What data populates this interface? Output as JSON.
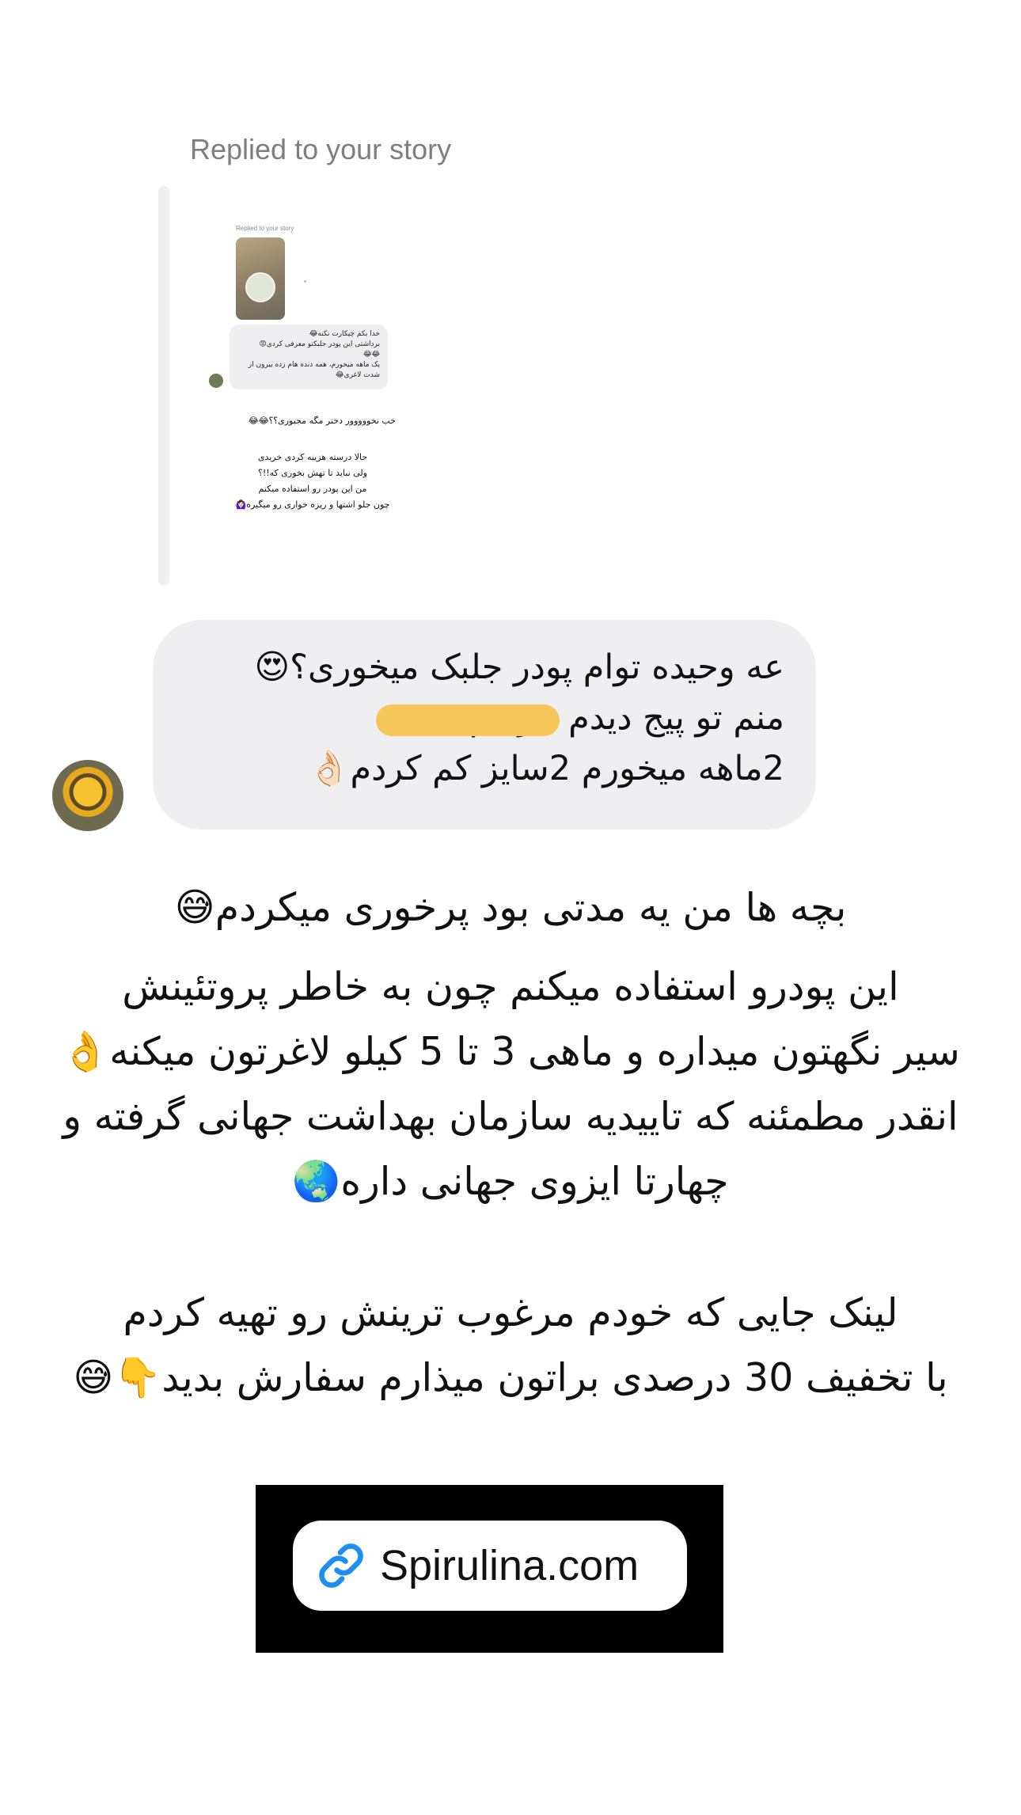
{
  "header": {
    "replied": "Replied to your story"
  },
  "story_thumbnail": {
    "replied": "Replied to your story",
    "bubble_lines": [
      "خدا بکم چیکارت نکنه😂",
      "برداشتی این پودر جلبکتو معرفی کردی😡",
      "😂😂",
      "یک ماهه میخورم، همه دنده هام زده بیرون از",
      "شدت لاغری😂"
    ],
    "reply": "خب نخووووور دختر مگه مجبوری؟؟😂😂",
    "caption_lines": [
      "حالا درسته هزینه کردی خریدی",
      "ولی نباید تا تهش بخوری که!!؟",
      "من این پودر رو استفاده میکنم",
      "چون جلو اشتها و ریزه خواری رو میگیره🙆🏻‍♀️"
    ]
  },
  "message": {
    "lines": [
      "عه وحیده توام پودر جلبک میخوری؟😍",
      "منم تو پیج دیدم خریدم",
      "2ماهه میخورم 2سایز کم کردم👌🏻"
    ]
  },
  "caption": {
    "line1": "بچه ها من یه مدتی بود پرخوری میکردم😅",
    "paragraph": [
      "این پودرو استفاده میکنم چون به خاطر پروتئینش",
      "سیر نگهتون میداره و ماهی 3 تا 5 کیلو لاغرتون میکنه👌",
      "انقدر مطمئنه که تاییدیه سازمان بهداشت جهانی گرفته و",
      "چهارتا ایزوی جهانی داره🌏"
    ],
    "cta": [
      "لینک جایی که خودم مرغوب ترینش رو تهیه کردم",
      "با تخفیف 30 درصدی براتون میذارم سفارش بدید👇😅"
    ]
  },
  "link_sticker": {
    "label": "Spirulina.com",
    "icon": "link-icon",
    "icon_color": "#1f8ef1"
  },
  "colors": {
    "bubble": "#efeff2",
    "muted": "#7d7d82",
    "censor": "#f7c65a",
    "sticker_bg": "#000000"
  }
}
